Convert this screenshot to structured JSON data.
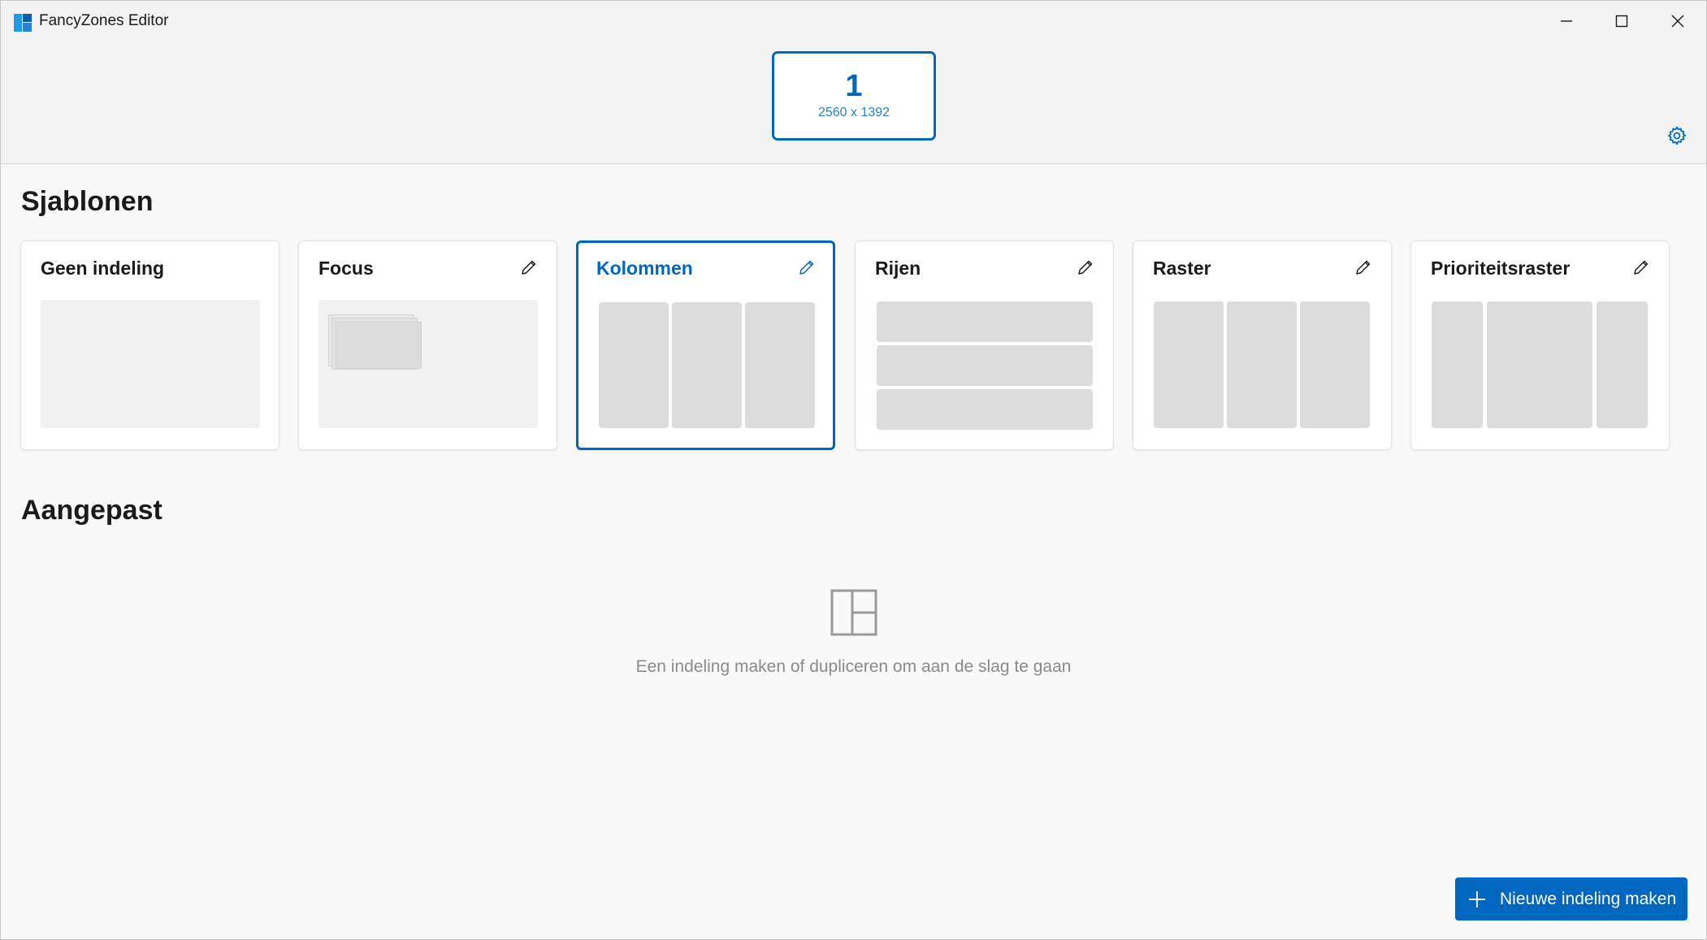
{
  "window": {
    "title": "FancyZones Editor"
  },
  "monitor": {
    "number": "1",
    "resolution": "2560 x 1392"
  },
  "sections": {
    "templates_title": "Sjablonen",
    "custom_title": "Aangepast"
  },
  "templates": [
    {
      "title": "Geen indeling",
      "editable": false,
      "selected": false,
      "preview": "blank"
    },
    {
      "title": "Focus",
      "editable": true,
      "selected": false,
      "preview": "focus"
    },
    {
      "title": "Kolommen",
      "editable": true,
      "selected": true,
      "preview": "columns"
    },
    {
      "title": "Rijen",
      "editable": true,
      "selected": false,
      "preview": "rows"
    },
    {
      "title": "Raster",
      "editable": true,
      "selected": false,
      "preview": "grid"
    },
    {
      "title": "Prioriteitsraster",
      "editable": true,
      "selected": false,
      "preview": "priority-grid"
    }
  ],
  "empty_state": {
    "icon": "layout-icon",
    "text": "Een indeling maken of dupliceren om aan de slag te gaan"
  },
  "actions": {
    "new_layout_label": "Nieuwe indeling maken"
  },
  "colors": {
    "accent": "#0067c0",
    "zone": "#dcdcdc",
    "background": "#f9f9f9"
  }
}
